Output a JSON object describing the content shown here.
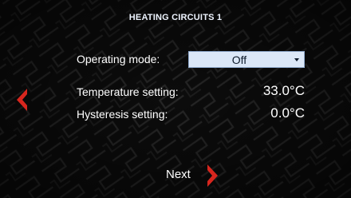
{
  "screen": {
    "title": "HEATING CIRCUITS 1"
  },
  "settings": {
    "operating_mode": {
      "label": "Operating mode:",
      "value": "Off"
    },
    "temperature": {
      "label": "Temperature setting:",
      "value": "33.0°C"
    },
    "hysteresis": {
      "label": "Hysteresis setting:",
      "value": "0.0°C"
    }
  },
  "navigation": {
    "next_label": "Next"
  },
  "icons": {
    "back": "chevron-left-icon",
    "next": "chevron-right-icon",
    "dropdown": "caret-down-icon"
  },
  "colors": {
    "accent_red": "#d7261e",
    "dropdown_bg": "#dbe7f7"
  }
}
